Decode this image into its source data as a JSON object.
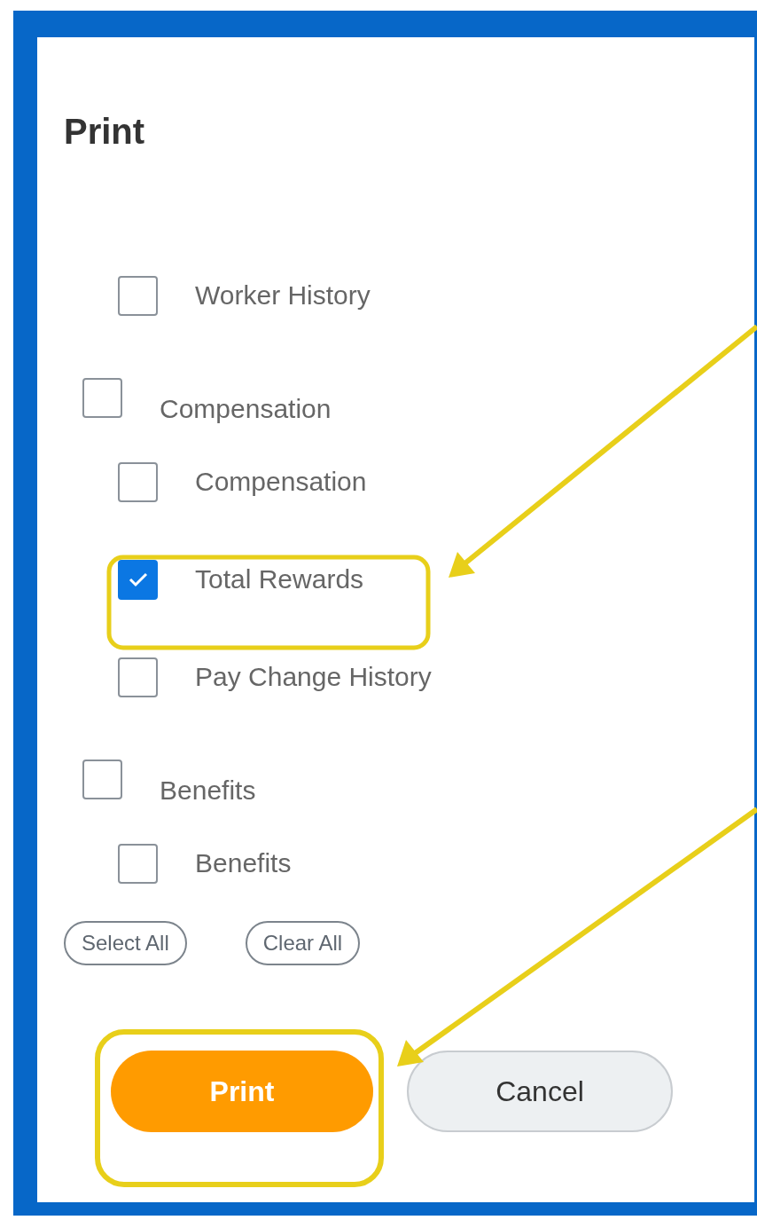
{
  "title": "Print",
  "options": [
    {
      "label": "Worker History",
      "checked": false
    }
  ],
  "groups": [
    {
      "label": "Compensation",
      "checked": false,
      "children": [
        {
          "label": "Compensation",
          "checked": false
        },
        {
          "label": "Total Rewards",
          "checked": true
        },
        {
          "label": "Pay Change History",
          "checked": false
        }
      ]
    },
    {
      "label": "Benefits",
      "checked": false,
      "children": [
        {
          "label": "Benefits",
          "checked": false
        }
      ]
    }
  ],
  "select_all": "Select All",
  "clear_all": "Clear All",
  "buttons": [
    {
      "label": "Print",
      "kind": "primary"
    },
    {
      "label": "Cancel",
      "kind": "secondary"
    }
  ]
}
